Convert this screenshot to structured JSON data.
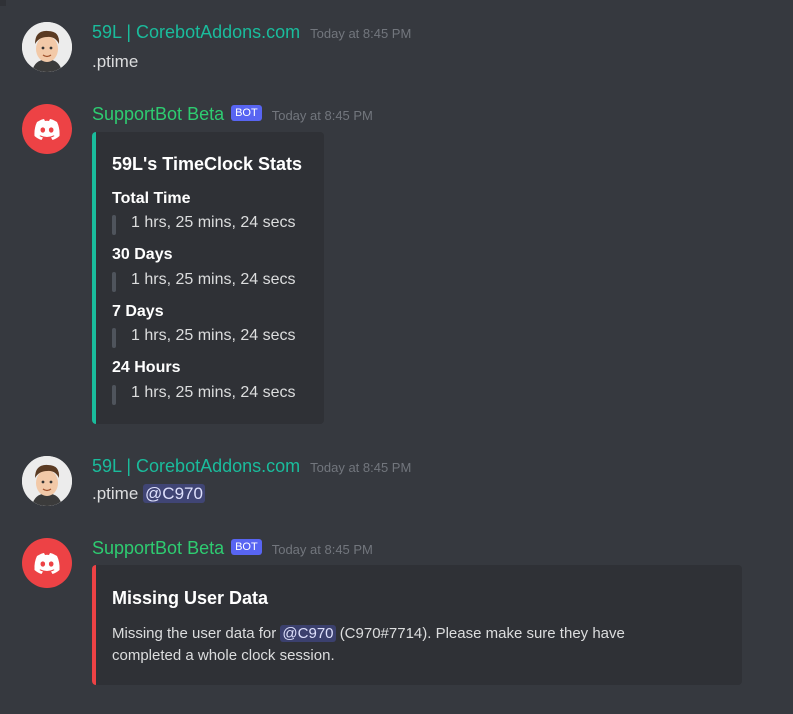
{
  "messages": [
    {
      "author": "59L | CorebotAddons.com",
      "timestamp": "Today at 8:45 PM",
      "text": ".ptime"
    },
    {
      "author": "SupportBot Beta",
      "badge": "BOT",
      "timestamp": "Today at 8:45 PM",
      "embed": {
        "title": "59L's TimeClock Stats",
        "fields": [
          {
            "name": "Total Time",
            "value": "1 hrs, 25 mins, 24 secs"
          },
          {
            "name": "30 Days",
            "value": "1 hrs, 25 mins, 24 secs"
          },
          {
            "name": "7 Days",
            "value": "1 hrs, 25 mins, 24 secs"
          },
          {
            "name": "24 Hours",
            "value": "1 hrs, 25 mins, 24 secs"
          }
        ]
      }
    },
    {
      "author": "59L | CorebotAddons.com",
      "timestamp": "Today at 8:45 PM",
      "text": ".ptime",
      "mention": "@C970"
    },
    {
      "author": "SupportBot Beta",
      "badge": "BOT",
      "timestamp": "Today at 8:45 PM",
      "embed": {
        "title": "Missing User Data",
        "desc_before": "Missing the user data for",
        "mention": "@C970",
        "desc_after_line1": "(C970#7714). Please make sure they have",
        "desc_line2": "completed a whole clock session."
      }
    }
  ],
  "colors": {
    "background": "#36393f",
    "embed": "#2f3136",
    "accent_teal": "#1abc9c",
    "accent_red": "#ed4245",
    "blurple": "#5865f2"
  },
  "icons": {
    "user_avatar": "cartoon-person-avatar",
    "bot_avatar": "discord-logo-icon"
  }
}
